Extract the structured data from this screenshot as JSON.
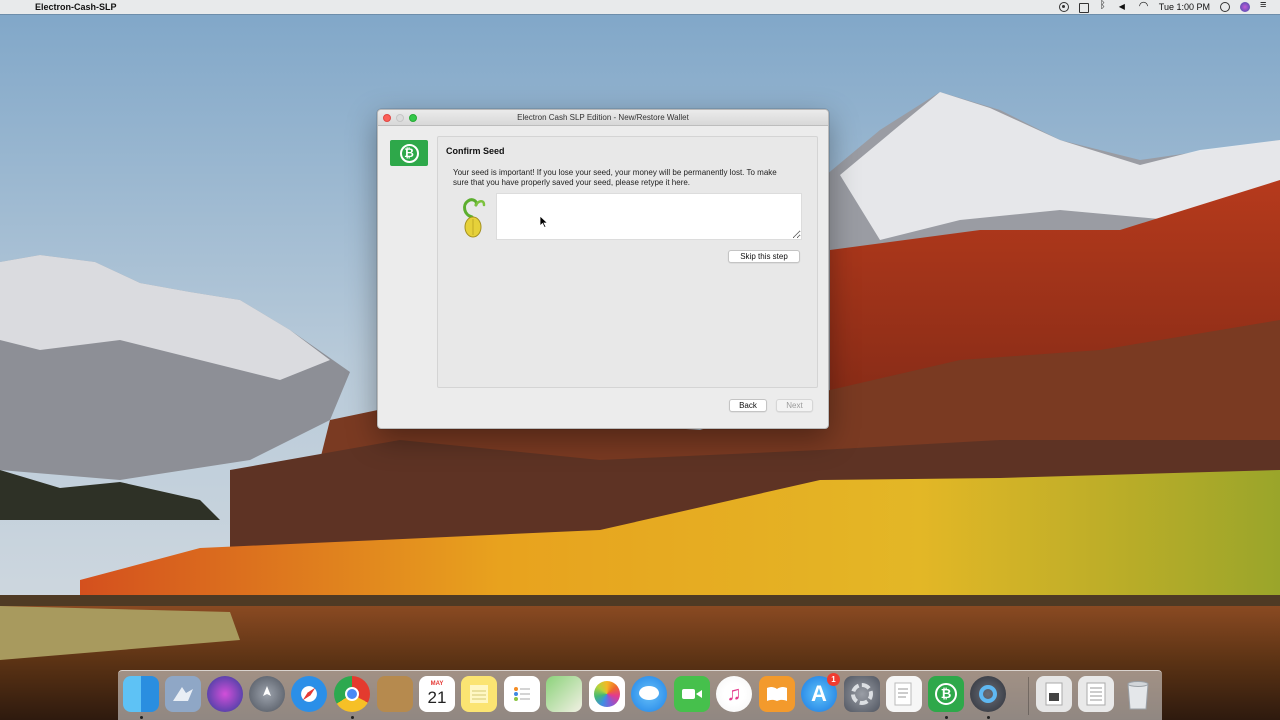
{
  "menubar": {
    "app_name": "Electron-Cash-SLP",
    "clock": "Tue 1:00 PM"
  },
  "window": {
    "title": "Electron Cash SLP Edition -  New/Restore Wallet",
    "logo_glyph": "₿"
  },
  "confirm_seed": {
    "title": "Confirm Seed",
    "message": "Your seed is important! If you lose your seed, your money will be permanently lost. To make sure that you have properly saved your seed, please retype it here.",
    "seed_value": "",
    "skip_label": "Skip this step"
  },
  "nav": {
    "back_label": "Back",
    "next_label": "Next"
  },
  "dock": {
    "calendar_month": "MAY",
    "calendar_day": "21",
    "app_store_badge": "1",
    "electron_cash_glyph": "₿"
  },
  "colors": {
    "brand_green": "#2ea84a",
    "close": "#fc5f57",
    "zoom": "#34c84a"
  }
}
